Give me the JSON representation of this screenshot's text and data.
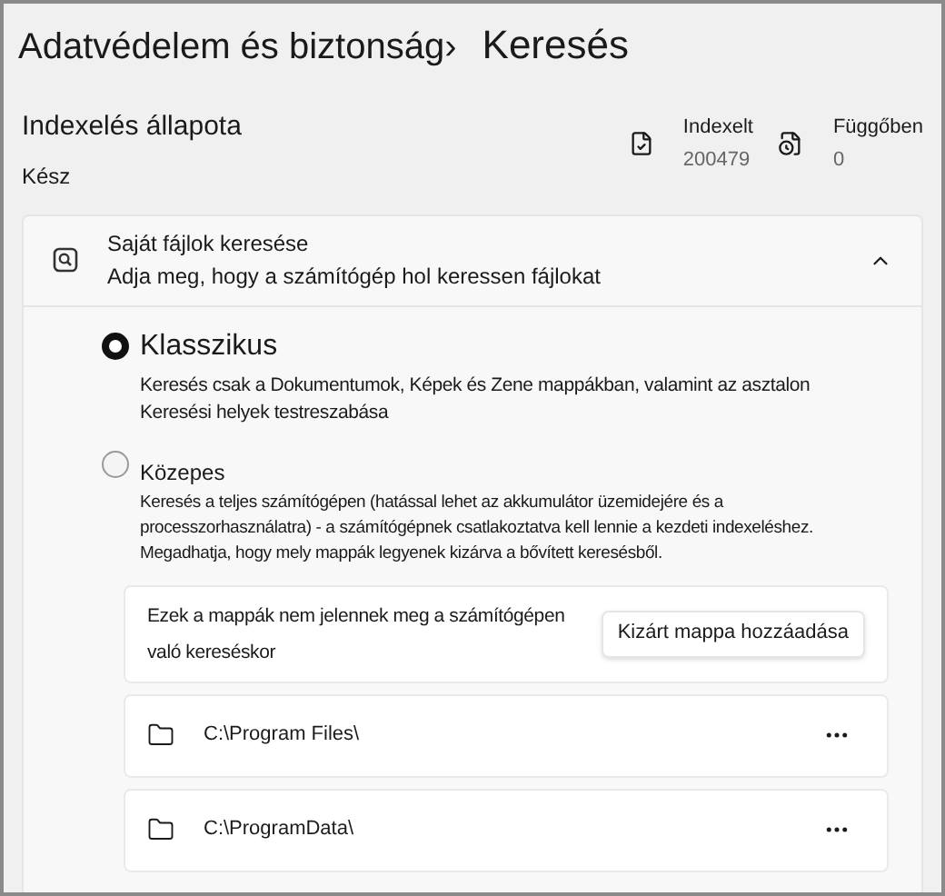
{
  "breadcrumb": {
    "parent": "Adatvédelem és biztonság",
    "separator": "›",
    "current": "Keresés"
  },
  "indexing": {
    "title": "Indexelés állapota",
    "status": "Kész",
    "stats": [
      {
        "kind": "indexed",
        "label": "Indexelt",
        "value": "200479"
      },
      {
        "kind": "pending",
        "label": "Függőben",
        "value": "0"
      }
    ]
  },
  "section": {
    "title": "Saját fájlok keresése",
    "subtitle": "Adja meg, hogy a számítógép hol keressen fájlokat",
    "expanded": true,
    "options": [
      {
        "label": "Klasszikus",
        "selected": true,
        "description": [
          "Keresés csak a Dokumentumok, Képek és Zene mappákban, valamint az asztalon",
          "Keresési helyek testreszabása"
        ]
      },
      {
        "label": "Közepes",
        "selected": false,
        "description": [
          "Keresés a teljes számítógépen (hatással lehet az akkumulátor üzemidejére és a processzorhasználatra) - a számítógépnek csatlakoztatva kell lennie a kezdeti indexeléshez. Megadhatja, hogy mely mappák legyenek kizárva a bővített keresésből."
        ]
      }
    ],
    "excluded": {
      "text": "Ezek a mappák nem jelennek meg a számítógépen való kereséskor",
      "button": "Kizárt mappa hozzáadása",
      "folders": [
        "C:\\Program Files\\",
        "C:\\ProgramData\\"
      ]
    }
  }
}
